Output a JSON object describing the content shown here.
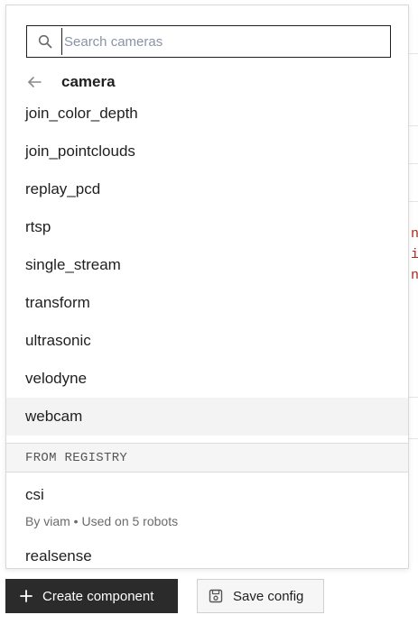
{
  "search": {
    "placeholder": "Search cameras",
    "value": ""
  },
  "breadcrumb": {
    "title": "camera"
  },
  "models": [
    {
      "label": "join_color_depth"
    },
    {
      "label": "join_pointclouds"
    },
    {
      "label": "replay_pcd"
    },
    {
      "label": "rtsp"
    },
    {
      "label": "single_stream"
    },
    {
      "label": "transform"
    },
    {
      "label": "ultrasonic"
    },
    {
      "label": "velodyne"
    },
    {
      "label": "webcam"
    }
  ],
  "registry": {
    "header": "FROM REGISTRY",
    "items": [
      {
        "name": "csi",
        "meta": "By viam • Used on 5 robots"
      },
      {
        "name": "realsense"
      }
    ]
  },
  "background": {
    "code_fragments": [
      "n",
      "i",
      "n"
    ]
  },
  "toolbar": {
    "create_label": "Create component",
    "save_label": "Save config"
  },
  "colors": {
    "primary_button": "#2b2b2b",
    "highlight_row": "#f3f3f3",
    "error_code": "#b3261e"
  }
}
